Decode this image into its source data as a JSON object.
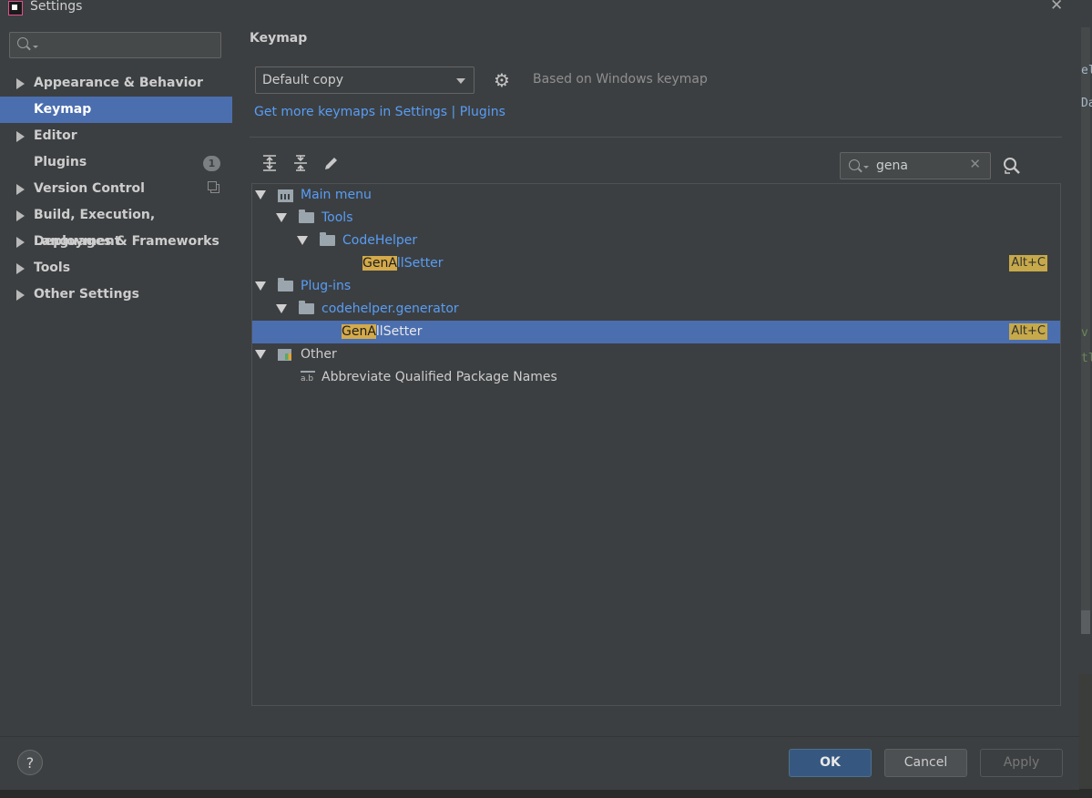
{
  "window": {
    "title": "Settings"
  },
  "sidebar": {
    "search": {
      "placeholder": ""
    },
    "items": [
      {
        "label": "Appearance & Behavior",
        "expandable": true
      },
      {
        "label": "Keymap",
        "selected": true
      },
      {
        "label": "Editor",
        "expandable": true
      },
      {
        "label": "Plugins",
        "badge": "1"
      },
      {
        "label": "Version Control",
        "expandable": true,
        "icon": "copy-icon"
      },
      {
        "label": "Build, Execution, Deployment",
        "expandable": true
      },
      {
        "label": "Languages & Frameworks",
        "expandable": true
      },
      {
        "label": "Tools",
        "expandable": true
      },
      {
        "label": "Other Settings",
        "expandable": true
      }
    ]
  },
  "main": {
    "breadcrumb": "Keymap",
    "keymap_select": {
      "value": "Default copy"
    },
    "based_on": "Based on Windows keymap",
    "get_more_link": "Get more keymaps in Settings | Plugins",
    "toolbar": {
      "icons": [
        "expand-all-icon",
        "collapse-all-icon",
        "edit-icon"
      ]
    },
    "search": {
      "value": "gena"
    },
    "tree": [
      {
        "label": "Main menu",
        "style": "link",
        "icon": "menu-icon"
      },
      {
        "label": "Tools",
        "style": "link",
        "icon": "folder-icon"
      },
      {
        "label": "CodeHelper",
        "style": "link",
        "icon": "folder-icon"
      },
      {
        "match": "GenA",
        "rest": "llSetter",
        "shortcut": "Alt+C"
      },
      {
        "label": "Plug-ins",
        "style": "link",
        "icon": "folder-icon"
      },
      {
        "label": "codehelper.generator",
        "style": "link",
        "icon": "folder-icon"
      },
      {
        "match": "GenA",
        "rest": "llSetter",
        "shortcut": "Alt+C",
        "selected": true
      },
      {
        "label": "Other",
        "style": "plain",
        "icon": "other-icon"
      },
      {
        "label": "Abbreviate Qualified Package Names",
        "style": "plain",
        "icon": "abbreviate-icon"
      }
    ]
  },
  "footer": {
    "help": "?",
    "ok": "OK",
    "cancel": "Cancel",
    "apply": "Apply"
  },
  "background_editor": {
    "snippet_top": [
      "el",
      "Da"
    ],
    "snippet_code": [
      "v",
      "tl"
    ]
  },
  "colors": {
    "selection": "#4b6eaf",
    "link": "#589df6",
    "match_highlight": "#d4aa4a",
    "background": "#3c3f41"
  }
}
